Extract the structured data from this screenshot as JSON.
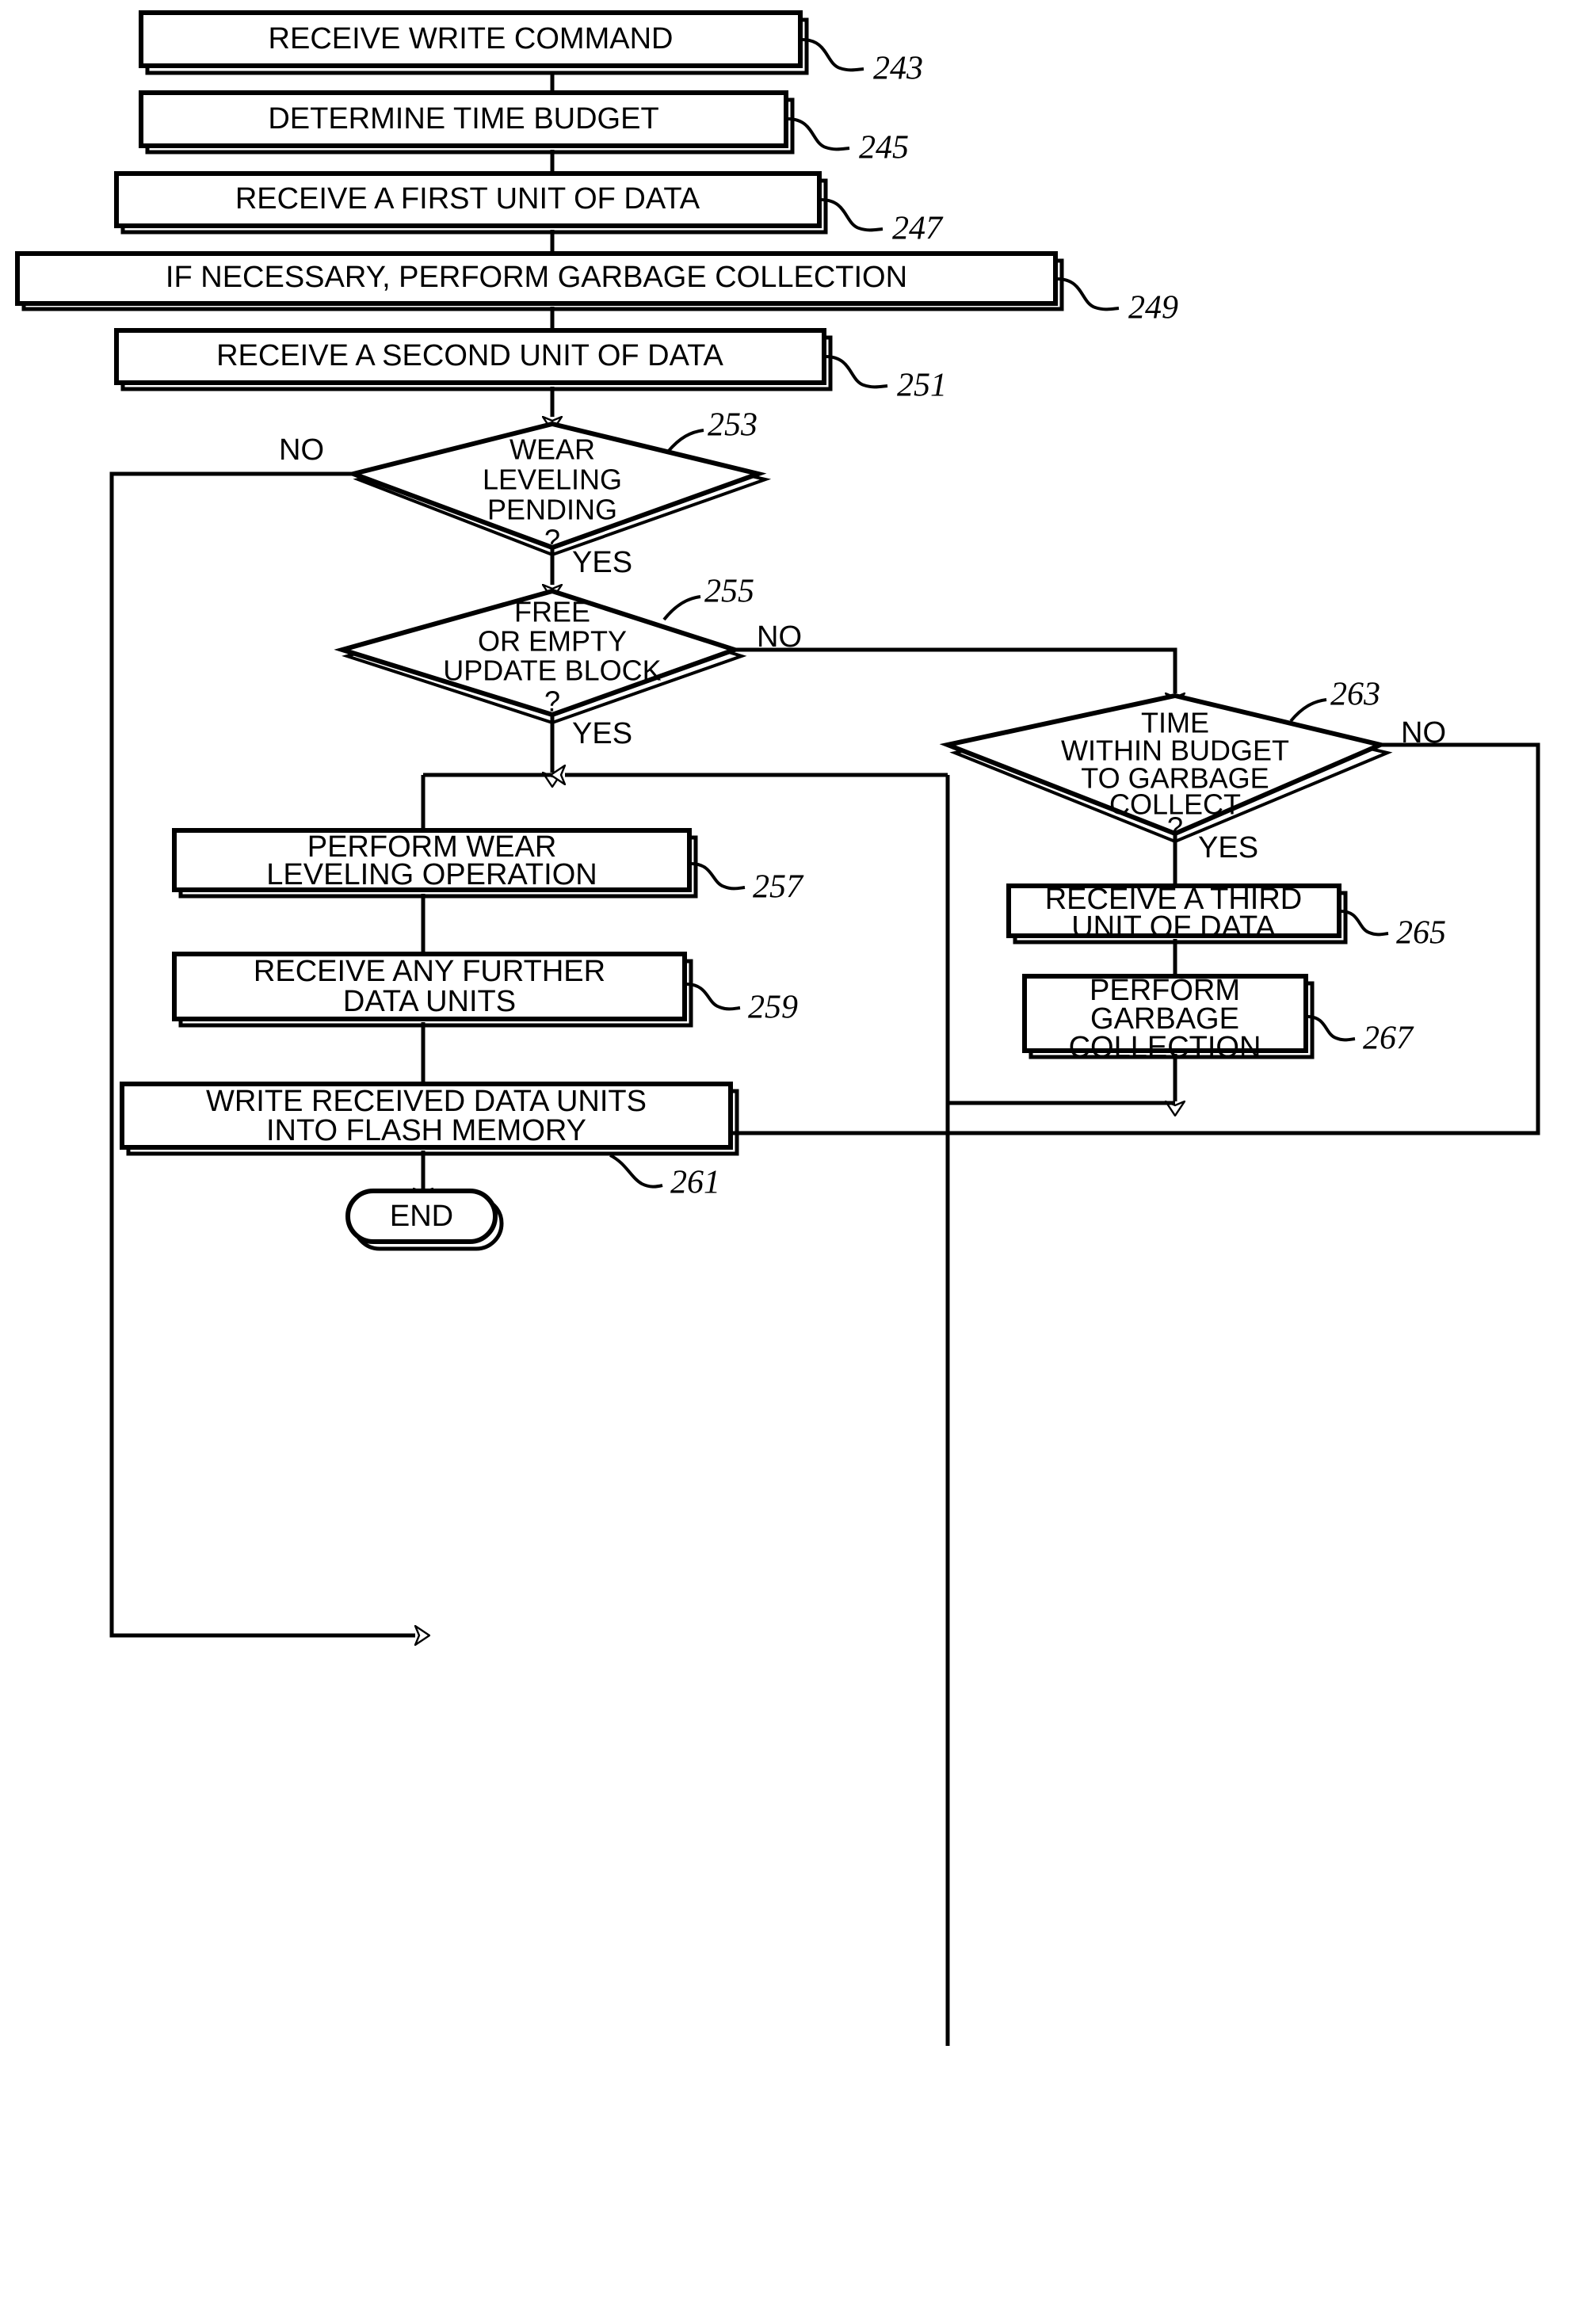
{
  "figure": {
    "type": "flowchart",
    "title": "",
    "background_color": "#ffffff",
    "line_color": "#000000"
  },
  "nodes": {
    "n243": {
      "ref": "243",
      "shape": "process",
      "lines": [
        "RECEIVE WRITE COMMAND"
      ]
    },
    "n245": {
      "ref": "245",
      "shape": "process",
      "lines": [
        "DETERMINE TIME BUDGET"
      ]
    },
    "n247": {
      "ref": "247",
      "shape": "process",
      "lines": [
        "RECEIVE A FIRST UNIT OF DATA"
      ]
    },
    "n249": {
      "ref": "249",
      "shape": "process",
      "lines": [
        "IF NECESSARY, PERFORM GARBAGE COLLECTION"
      ]
    },
    "n251": {
      "ref": "251",
      "shape": "process",
      "lines": [
        "RECEIVE A SECOND UNIT OF DATA"
      ]
    },
    "n253": {
      "ref": "253",
      "shape": "decision",
      "lines": [
        "WEAR",
        "LEVELING",
        "PENDING",
        "?"
      ]
    },
    "n255": {
      "ref": "255",
      "shape": "decision",
      "lines": [
        "FREE",
        "OR EMPTY",
        "UPDATE BLOCK",
        "?"
      ]
    },
    "n257": {
      "ref": "257",
      "shape": "process",
      "lines": [
        "PERFORM WEAR",
        "LEVELING OPERATION"
      ]
    },
    "n259": {
      "ref": "259",
      "shape": "process",
      "lines": [
        "RECEIVE ANY FURTHER",
        "DATA UNITS"
      ]
    },
    "n261": {
      "ref": "261",
      "shape": "process",
      "lines": [
        "WRITE RECEIVED DATA UNITS",
        "INTO FLASH MEMORY"
      ]
    },
    "n263": {
      "ref": "263",
      "shape": "decision",
      "lines": [
        "TIME",
        "WITHIN BUDGET",
        "TO GARBAGE",
        "COLLECT",
        "?"
      ]
    },
    "n265": {
      "ref": "265",
      "shape": "process",
      "lines": [
        "RECEIVE A THIRD",
        "UNIT OF DATA"
      ]
    },
    "n267": {
      "ref": "267",
      "shape": "process",
      "lines": [
        "PERFORM",
        "GARBAGE",
        "COLLECTION"
      ]
    },
    "nend": {
      "ref": "",
      "shape": "terminal",
      "lines": [
        "END"
      ]
    }
  },
  "edge_labels": {
    "e253_no": "NO",
    "e253_yes": "YES",
    "e255_no": "NO",
    "e255_yes": "YES",
    "e263_no": "NO",
    "e263_yes": "YES"
  },
  "ref_numbers": [
    "243",
    "245",
    "247",
    "249",
    "251",
    "253",
    "255",
    "257",
    "259",
    "261",
    "263",
    "265",
    "267"
  ]
}
